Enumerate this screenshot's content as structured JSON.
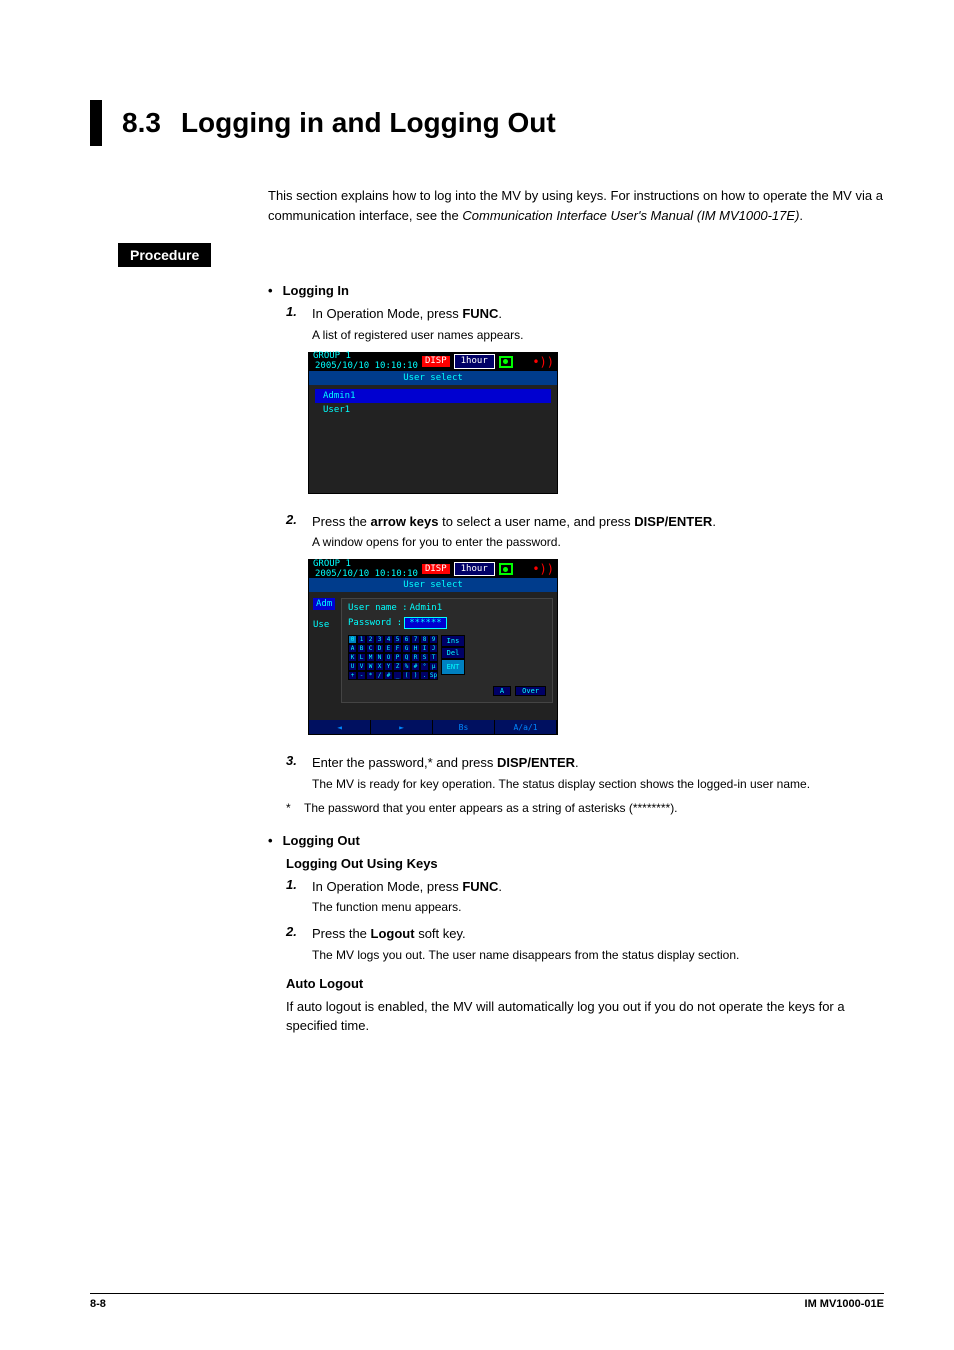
{
  "section": {
    "number": "8.3",
    "title": "Logging in and Logging Out"
  },
  "intro": {
    "p1a": "This section explains how to log into the MV by using keys. For instructions on how to operate the MV via a communication interface, see the ",
    "p1b": "Communication Interface User's Manual (IM MV1000-17E)",
    "p1c": "."
  },
  "procedure_label": "Procedure",
  "login": {
    "heading": "Logging In",
    "step1a": "In Operation Mode, press ",
    "step1b": "FUNC",
    "step1c": ".",
    "step1_small": "A list of registered user names appears.",
    "step2a": "Press the ",
    "step2b": "arrow keys",
    "step2c": " to select a user name, and press ",
    "step2d": "DISP/ENTER",
    "step2e": ".",
    "step2_small": "A window opens for you to enter the password.",
    "step3a": "Enter the password,* and press ",
    "step3b": "DISP/ENTER",
    "step3c": ".",
    "step3_small": "The MV is ready for key operation. The status display section shows the logged-in user name.",
    "note": "The password that you enter appears as a string of asterisks (********)."
  },
  "logout": {
    "heading": "Logging Out",
    "subheading": "Logging Out Using Keys",
    "step1a": "In Operation Mode, press ",
    "step1b": "FUNC",
    "step1c": ".",
    "step1_small": "The function menu appears.",
    "step2a": "Press the ",
    "step2b": "Logout",
    "step2c": " soft key.",
    "step2_small": "The MV logs you out. The user name disappears from the status display section.",
    "auto_head": "Auto Logout",
    "auto_text": "If auto logout is enabled, the MV will automatically log you out if you do not operate the keys for a specified time."
  },
  "shot1": {
    "group": "GROUP 1",
    "ts": "2005/10/10 10:10:10",
    "disp": "DISP",
    "hour": "1hour",
    "bar": "User select",
    "item_sel": "Admin1",
    "item2": "User1"
  },
  "shot2": {
    "group": "GROUP 1",
    "ts": "2005/10/10 10:10:10",
    "disp": "DISP",
    "hour": "1hour",
    "bar": "User select",
    "side_adm": "Adm",
    "side_use": "Use",
    "un_label": "User  name :",
    "un_value": "Admin1",
    "pw_label": "Password   :",
    "pw_value": "******",
    "ins": "Ins",
    "del": "Del",
    "ent": "ENT",
    "stA": "A",
    "stOver": "Over",
    "f_left": "◄",
    "f_right": "►",
    "f_bs": "Bs",
    "f_mode": "A/a/1"
  },
  "keys_rows": [
    [
      "0",
      "1",
      "2",
      "3",
      "4",
      "5",
      "6",
      "7",
      "8",
      "9"
    ],
    [
      "A",
      "B",
      "C",
      "D",
      "E",
      "F",
      "G",
      "H",
      "I",
      "J"
    ],
    [
      "K",
      "L",
      "M",
      "N",
      "O",
      "P",
      "Q",
      "R",
      "S",
      "T"
    ],
    [
      "U",
      "V",
      "W",
      "X",
      "Y",
      "Z",
      "%",
      "#",
      "°",
      "µ"
    ],
    [
      "+",
      "-",
      "*",
      "/",
      "#",
      "_",
      "(",
      ")",
      ".",
      "Sp"
    ]
  ],
  "footer": {
    "page": "8-8",
    "doc": "IM MV1000-01E"
  }
}
